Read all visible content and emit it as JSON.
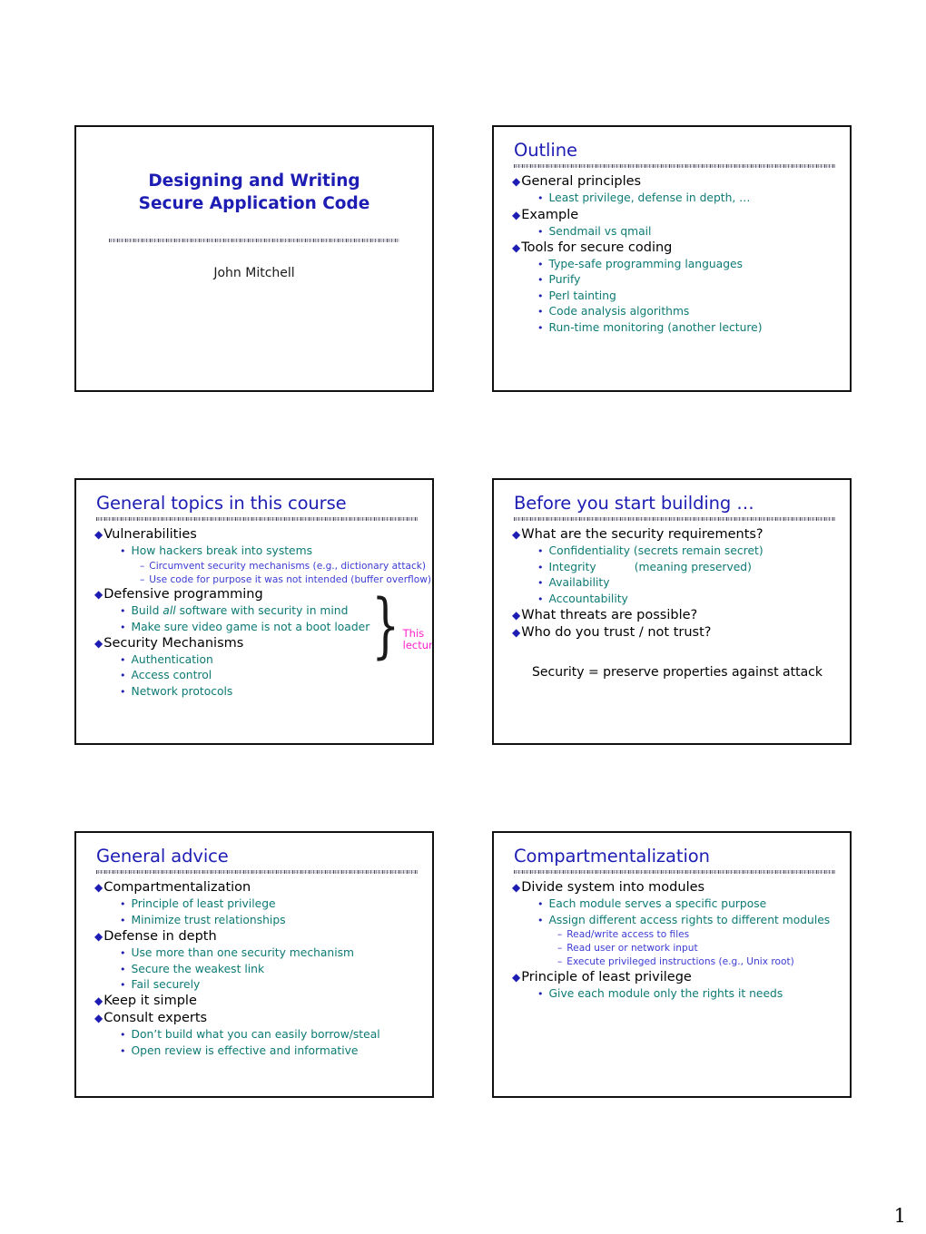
{
  "page": {
    "number": "1"
  },
  "slides": [
    {
      "kind": "title",
      "name": "slide-title-page",
      "heading_line1": "Designing and Writing",
      "heading_line2": "Secure Application Code",
      "author": "John Mitchell"
    },
    {
      "kind": "bullets",
      "name": "slide-outline",
      "title": "Outline",
      "items": [
        {
          "level": 1,
          "text": "General principles"
        },
        {
          "level": 2,
          "text": "Least privilege, defense in depth, …"
        },
        {
          "level": 1,
          "text": "Example"
        },
        {
          "level": 2,
          "text": "Sendmail vs qmail"
        },
        {
          "level": 1,
          "text": "Tools for secure coding"
        },
        {
          "level": 2,
          "text": "Type-safe programming languages"
        },
        {
          "level": 2,
          "text": "Purify"
        },
        {
          "level": 2,
          "text": "Perl tainting"
        },
        {
          "level": 2,
          "text": "Code analysis algorithms"
        },
        {
          "level": 2,
          "text": "Run-time monitoring (another lecture)"
        }
      ]
    },
    {
      "kind": "bullets",
      "name": "slide-general-topics",
      "title": "General topics in this course",
      "annotation": {
        "label_line1": "This",
        "label_line2": "lecture",
        "color": "#ff22cc"
      },
      "items": [
        {
          "level": 1,
          "text": "Vulnerabilities"
        },
        {
          "level": 2,
          "text": "How hackers break into systems"
        },
        {
          "level": 3,
          "text": "Circumvent security mechanisms (e.g., dictionary attack)"
        },
        {
          "level": 3,
          "text": "Use code for purpose it was not intended (buffer overflow)"
        },
        {
          "level": 1,
          "text": "Defensive programming"
        },
        {
          "level": 2,
          "text": "Build all software with security in mind",
          "italic_word": "all"
        },
        {
          "level": 2,
          "text": "Make sure video game is not a boot loader"
        },
        {
          "level": 1,
          "text": "Security Mechanisms"
        },
        {
          "level": 2,
          "text": "Authentication"
        },
        {
          "level": 2,
          "text": "Access control"
        },
        {
          "level": 2,
          "text": "Network protocols"
        }
      ]
    },
    {
      "kind": "bullets",
      "name": "slide-before-you-start-building",
      "title": "Before you start building …",
      "items": [
        {
          "level": 1,
          "text": "What are the security requirements?"
        },
        {
          "level": 2,
          "text": "Confidentiality (secrets remain secret)"
        },
        {
          "level": 2,
          "text": "Integrity",
          "tab_text": "(meaning preserved)"
        },
        {
          "level": 2,
          "text": "Availability"
        },
        {
          "level": 2,
          "text": "Accountability"
        },
        {
          "level": 1,
          "text": "What threats are possible?"
        },
        {
          "level": 1,
          "text": "Who do you trust / not trust?"
        }
      ],
      "free_text": "Security = preserve properties against attack"
    },
    {
      "kind": "bullets",
      "name": "slide-general-advice",
      "title": "General advice",
      "items": [
        {
          "level": 1,
          "text": "Compartmentalization"
        },
        {
          "level": 2,
          "text": "Principle of least privilege"
        },
        {
          "level": 2,
          "text": "Minimize trust relationships"
        },
        {
          "level": 1,
          "text": "Defense in depth"
        },
        {
          "level": 2,
          "text": "Use more than one security mechanism"
        },
        {
          "level": 2,
          "text": "Secure the weakest link"
        },
        {
          "level": 2,
          "text": "Fail securely"
        },
        {
          "level": 1,
          "text": "Keep it simple"
        },
        {
          "level": 1,
          "text": "Consult experts"
        },
        {
          "level": 2,
          "text": "Don’t build what you can easily borrow/steal"
        },
        {
          "level": 2,
          "text": "Open review is effective and informative"
        }
      ]
    },
    {
      "kind": "bullets",
      "name": "slide-compartmentalization",
      "title": "Compartmentalization",
      "items": [
        {
          "level": 1,
          "text": "Divide system into modules"
        },
        {
          "level": 2,
          "text": "Each module serves a specific purpose"
        },
        {
          "level": 2,
          "text": "Assign different access rights to different modules"
        },
        {
          "level": 3,
          "text": "Read/write access to files"
        },
        {
          "level": 3,
          "text": "Read user or network input"
        },
        {
          "level": 3,
          "text": "Execute privileged instructions (e.g., Unix root)"
        },
        {
          "level": 1,
          "text": "Principle of least privilege"
        },
        {
          "level": 2,
          "text": "Give each module only the rights it needs"
        }
      ]
    }
  ],
  "markers": {
    "level1": "◆",
    "level2": "•",
    "level3": "–",
    "brace": "}"
  },
  "colors": {
    "title": "#1d1db4",
    "level1": "#000000",
    "level2": "#0d7a74",
    "level3": "#3b3bd4",
    "annotation": "#ff22cc",
    "frame": "#111111"
  }
}
